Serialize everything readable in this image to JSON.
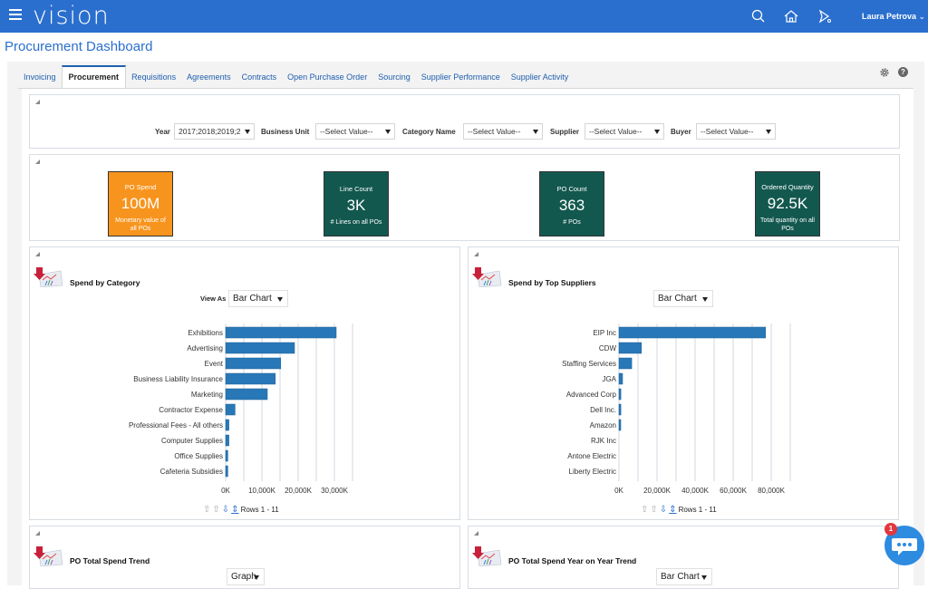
{
  "app": {
    "logo": "vision",
    "user": "Laura Petrova",
    "page_title": "Procurement Dashboard",
    "primary_color": "#2a6fce"
  },
  "icons": {
    "menu": "hamburger-icon",
    "search": "search-icon",
    "home": "home-icon",
    "notifications": "bell-icon",
    "settings": "gear-icon",
    "help": "help-icon",
    "help_glyph": "?",
    "chat": "chat-icon",
    "chat_badge": "1"
  },
  "tabs": [
    {
      "label": "Invoicing",
      "active": false
    },
    {
      "label": "Procurement",
      "active": true
    },
    {
      "label": "Requisitions",
      "active": false
    },
    {
      "label": "Agreements",
      "active": false
    },
    {
      "label": "Contracts",
      "active": false
    },
    {
      "label": "Open Purchase Order",
      "active": false
    },
    {
      "label": "Sourcing",
      "active": false
    },
    {
      "label": "Supplier Performance",
      "active": false
    },
    {
      "label": "Supplier Activity",
      "active": false
    }
  ],
  "filters": [
    {
      "label": "Year",
      "value": "2017;2018;2019;2"
    },
    {
      "label": "Business Unit",
      "value": "--Select Value--"
    },
    {
      "label": "Category Name",
      "value": "--Select Value--"
    },
    {
      "label": "Supplier",
      "value": "--Select Value--"
    },
    {
      "label": "Buyer",
      "value": "--Select Value--"
    }
  ],
  "kpis": [
    {
      "title": "PO Spend",
      "value": "100M",
      "subtitle": "Monetary value of all POs",
      "color": "#f7941d"
    },
    {
      "title": "Line Count",
      "value": "3K",
      "subtitle": "# Lines on all POs",
      "color": "#13584f"
    },
    {
      "title": "PO Count",
      "value": "363",
      "subtitle": "# POs",
      "color": "#13584f"
    },
    {
      "title": "Ordered Quantity",
      "value": "92.5K",
      "subtitle": "Total quantity on all POs",
      "color": "#13584f"
    }
  ],
  "panels": {
    "spend_by_category": {
      "title": "Spend by Category",
      "view_as_label": "View As",
      "view": "Bar Chart",
      "rows": "Rows 1 - 11"
    },
    "spend_by_suppliers": {
      "title": "Spend by Top Suppliers",
      "view": "Bar Chart",
      "rows": "Rows 1 - 11"
    },
    "po_spend_trend": {
      "title": "PO Total Spend Trend",
      "view": "Graph"
    },
    "po_yoy_trend": {
      "title": "PO Total Spend Year on Year Trend",
      "view": "Bar Chart"
    }
  },
  "chart_data": [
    {
      "type": "bar",
      "orientation": "horizontal",
      "title": "Spend by Category",
      "categories": [
        "Exhibitions",
        "Advertising",
        "Event",
        "Business Liability Insurance",
        "Marketing",
        "Contractor Expense",
        "Professional Fees - All others",
        "Computer Supplies",
        "Office Supplies",
        "Cafeteria Subsidies"
      ],
      "values": [
        30500,
        19000,
        15200,
        13700,
        11500,
        2600,
        900,
        900,
        600,
        600
      ],
      "unit": "K",
      "xlim": [
        0,
        35000
      ],
      "xticks": [
        0,
        10000,
        20000,
        30000
      ],
      "xtick_labels": [
        "0K",
        "10,000K",
        "20,000K",
        "30,000K"
      ],
      "grid_step": 5000,
      "bar_color": "#2878b8",
      "grid": true
    },
    {
      "type": "bar",
      "orientation": "horizontal",
      "title": "Spend by Top Suppliers",
      "categories": [
        "EIP Inc",
        "CDW",
        "Staffing Services",
        "JGA",
        "Advanced Corp",
        "Dell Inc.",
        "Amazon",
        "RJK Inc",
        "Antone Electric",
        "Liberty Electric"
      ],
      "values": [
        77000,
        11800,
        6700,
        1900,
        1000,
        1000,
        600,
        0,
        0,
        0
      ],
      "unit": "K",
      "xlim": [
        0,
        90000
      ],
      "xticks": [
        0,
        20000,
        40000,
        60000,
        80000
      ],
      "xtick_labels": [
        "0K",
        "20,000K",
        "40,000K",
        "60,000K",
        "80,000K"
      ],
      "grid_step": 10000,
      "bar_color": "#2878b8",
      "grid": true
    }
  ]
}
